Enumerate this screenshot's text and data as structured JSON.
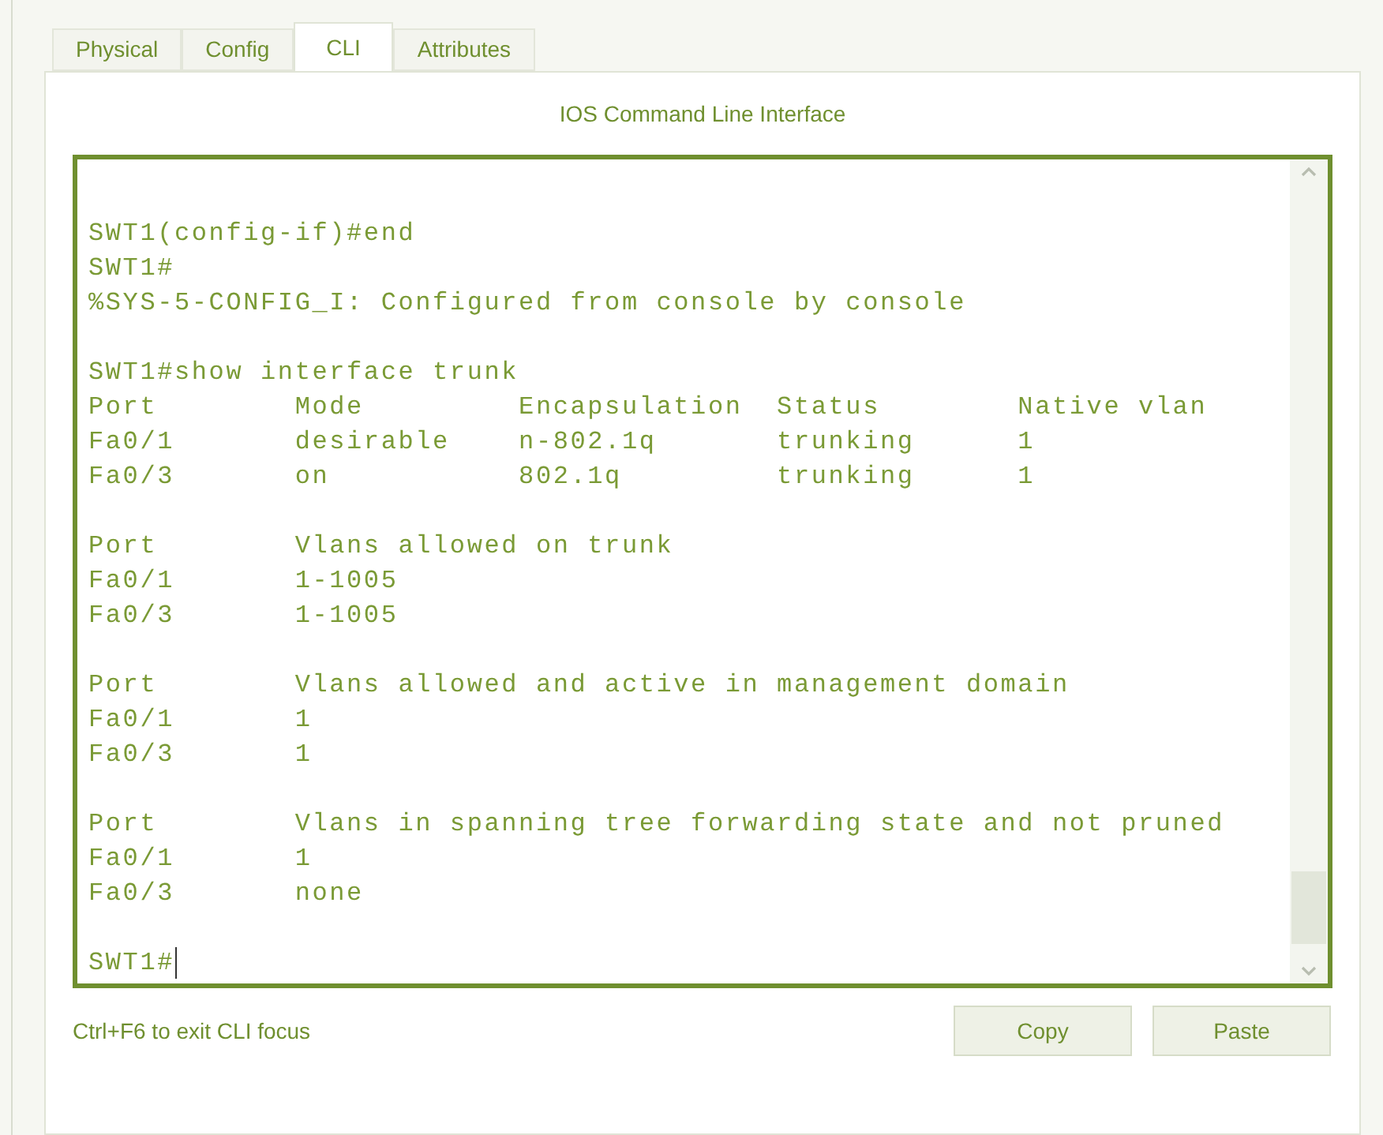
{
  "tabs": [
    {
      "label": "Physical",
      "selected": false
    },
    {
      "label": "Config",
      "selected": false
    },
    {
      "label": "CLI",
      "selected": true
    },
    {
      "label": "Attributes",
      "selected": false
    }
  ],
  "panel_title": "IOS Command Line Interface",
  "terminal": {
    "blocks": [
      [
        "SWT1(config-if)#end",
        "SWT1#",
        "%SYS-5-CONFIG_I: Configured from console by console"
      ],
      [
        "SWT1#show interface trunk",
        "Port        Mode         Encapsulation  Status        Native vlan",
        "Fa0/1       desirable    n-802.1q       trunking      1",
        "Fa0/3       on           802.1q         trunking      1"
      ],
      [
        "Port        Vlans allowed on trunk",
        "Fa0/1       1-1005",
        "Fa0/3       1-1005"
      ],
      [
        "Port        Vlans allowed and active in management domain",
        "Fa0/1       1",
        "Fa0/3       1"
      ],
      [
        "Port        Vlans in spanning tree forwarding state and not pruned",
        "Fa0/1       1",
        "Fa0/3       none"
      ]
    ],
    "prompt": {
      "text": "SWT1#",
      "cursor": true
    }
  },
  "hint": "Ctrl+F6 to exit CLI focus",
  "buttons": [
    "Copy",
    "Paste"
  ]
}
